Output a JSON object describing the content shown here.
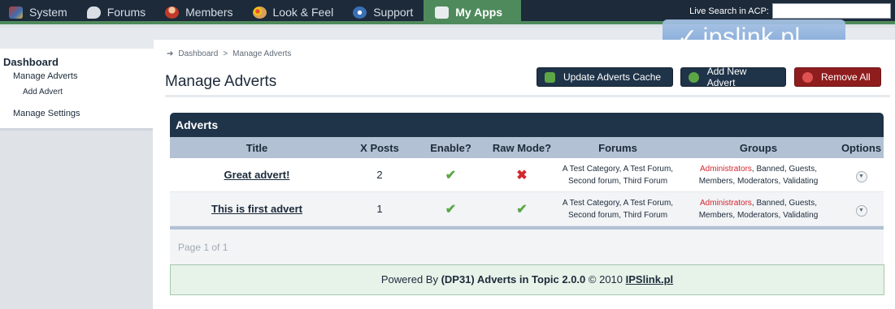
{
  "nav": {
    "items": [
      {
        "label": "System",
        "icon": "system-icon"
      },
      {
        "label": "Forums",
        "icon": "forums-icon"
      },
      {
        "label": "Members",
        "icon": "members-icon"
      },
      {
        "label": "Look & Feel",
        "icon": "look-feel-icon"
      },
      {
        "label": "Support",
        "icon": "support-icon"
      },
      {
        "label": "My Apps",
        "icon": "apps-icon",
        "active": true
      }
    ],
    "live_search_label": "Live Search in ACP:",
    "live_search_value": ""
  },
  "logo": {
    "text": "ipslink.pl"
  },
  "sidebar": {
    "heading": "Dashboard",
    "items": [
      {
        "label": "Manage Adverts"
      },
      {
        "label": "Add Advert"
      },
      {
        "label": "Manage Settings"
      }
    ]
  },
  "breadcrumb": {
    "home": "Dashboard",
    "sep": ">",
    "current": "Manage Adverts"
  },
  "page": {
    "title": "Manage Adverts"
  },
  "buttons": {
    "update": "Update Adverts Cache",
    "add": "Add New Advert",
    "remove": "Remove All"
  },
  "table": {
    "heading": "Adverts",
    "columns": [
      "Title",
      "X Posts",
      "Enable?",
      "Raw Mode?",
      "Forums",
      "Groups",
      "Options"
    ],
    "rows": [
      {
        "title": "Great advert!",
        "posts": "2",
        "enable": "✔",
        "raw": "✖",
        "forums_line1": "A Test Category, A Test Forum,",
        "forums_line2": "Second forum, Third Forum",
        "groups_admin": "Administrators",
        "groups_rest1": ", Banned, Guests,",
        "groups_line2": "Members, Moderators, Validating"
      },
      {
        "title": "This is first advert",
        "posts": "1",
        "enable": "✔",
        "raw": "✔",
        "forums_line1": "A Test Category, A Test Forum,",
        "forums_line2": "Second forum, Third Forum",
        "groups_admin": "Administrators",
        "groups_rest1": ", Banned, Guests,",
        "groups_line2": "Members, Moderators, Validating"
      }
    ],
    "pager": "Page 1 of 1"
  },
  "footer": {
    "prefix": "Powered By ",
    "product": "(DP31) Adverts in Topic 2.0.0",
    "middle": " © 2010  ",
    "link": "IPSlink.pl"
  },
  "colors": {
    "nav_bg": "#1c2a3a",
    "accent_green": "#4f8a5c",
    "button_dark": "#1f3349",
    "button_danger": "#8f1d1d",
    "admin_red": "#d3262f"
  }
}
